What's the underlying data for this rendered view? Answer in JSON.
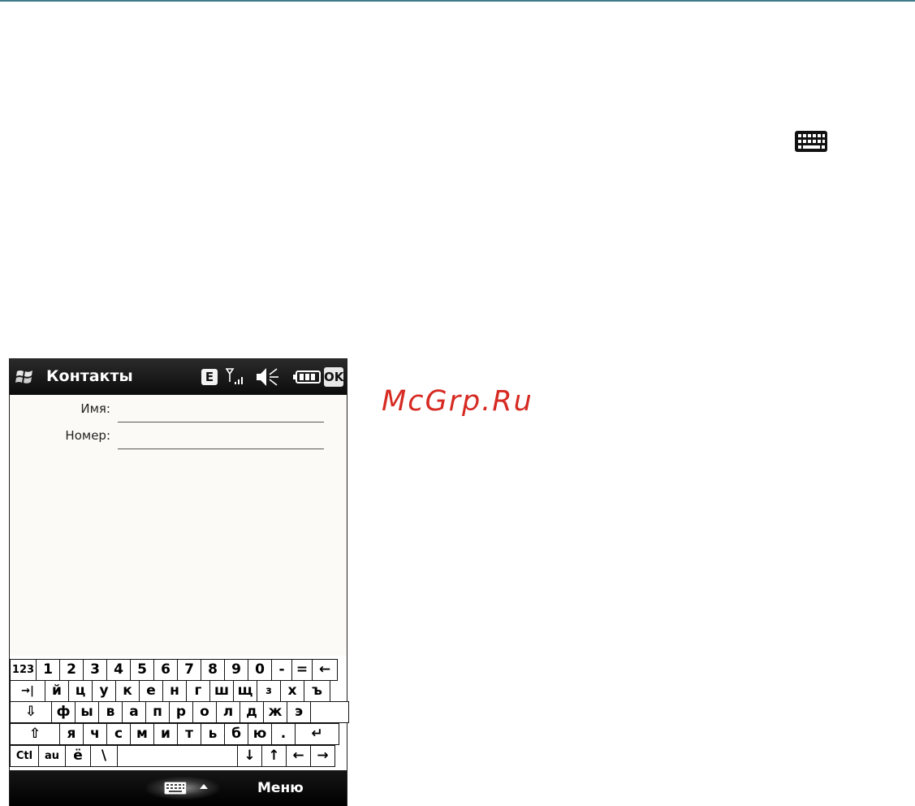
{
  "app": {
    "title": "Контакты",
    "network_badge": "E",
    "ok_label": "OK"
  },
  "form": {
    "name_label": "Имя:",
    "number_label": "Номер:"
  },
  "keyboard": {
    "rows": [
      [
        "123",
        "1",
        "2",
        "3",
        "4",
        "5",
        "6",
        "7",
        "8",
        "9",
        "0",
        "-",
        "=",
        "←"
      ],
      [
        "→|",
        "й",
        "ц",
        "у",
        "к",
        "е",
        "н",
        "г",
        "ш",
        "щ",
        "з",
        "х",
        "ъ"
      ],
      [
        "⇩",
        "ф",
        "ы",
        "в",
        "а",
        "п",
        "р",
        "о",
        "л",
        "д",
        "ж",
        "э"
      ],
      [
        "⇧",
        "я",
        "ч",
        "с",
        "м",
        "и",
        "т",
        "ь",
        "б",
        "ю",
        ".",
        "↵"
      ],
      [
        "Ctl",
        "au",
        "ё",
        "\\",
        "",
        "↓",
        "↑",
        "←",
        "→"
      ]
    ]
  },
  "softkeys": {
    "right_label": "Меню"
  },
  "watermark": "McGrp.Ru",
  "colors": {
    "watermark": "#d62a22",
    "titlebar": "#111111",
    "rule": "#3f7b8a"
  }
}
